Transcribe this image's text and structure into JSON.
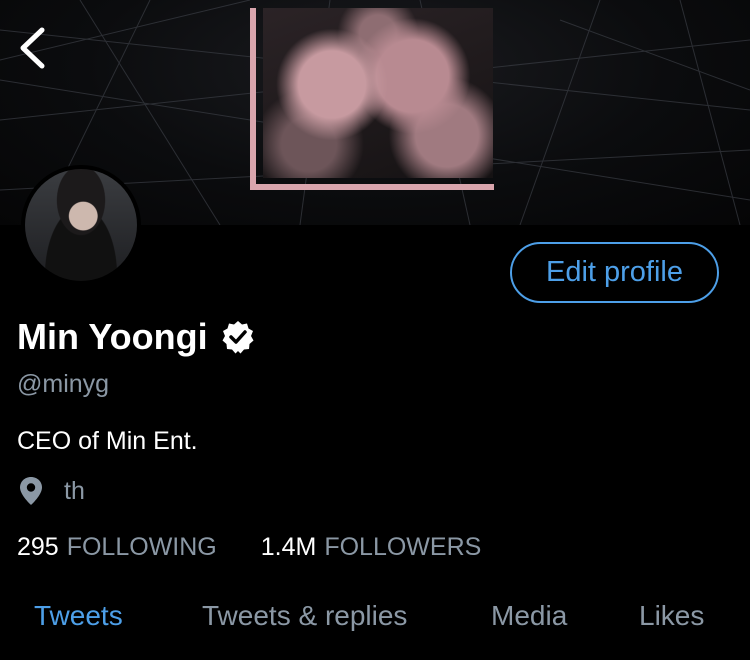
{
  "profile": {
    "display_name": "Min Yoongi",
    "handle": "@minyg",
    "bio": "CEO of Min Ent.",
    "location": "th",
    "verified": true
  },
  "actions": {
    "edit_profile_label": "Edit profile"
  },
  "stats": {
    "following_count": "295",
    "following_label": "FOLLOWING",
    "followers_count": "1.4M",
    "followers_label": "FOLLOWERS"
  },
  "tabs": [
    {
      "label": "Tweets",
      "active": true
    },
    {
      "label": "Tweets & replies",
      "active": false
    },
    {
      "label": "Media",
      "active": false
    },
    {
      "label": "Likes",
      "active": false
    }
  ],
  "icons": {
    "back": "chevron-left-icon",
    "verified": "verified-badge-icon",
    "location": "location-pin-icon"
  },
  "colors": {
    "accent": "#4d9fe8",
    "secondary_text": "#8b98a5",
    "background": "#000000",
    "banner_frame": "#d9a5ad"
  }
}
